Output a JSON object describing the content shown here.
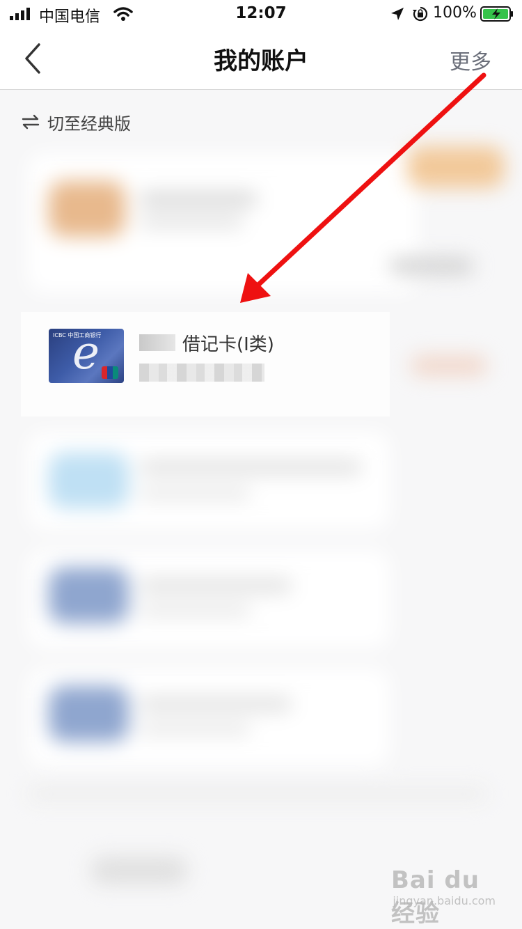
{
  "status_bar": {
    "carrier": "中国电信",
    "time": "12:07",
    "battery": "100%"
  },
  "nav": {
    "title": "我的账户",
    "more_label": "更多"
  },
  "switch_version": {
    "label": "切至经典版"
  },
  "account": {
    "title": "借记卡(Ⅰ类)",
    "card_brand": "ICBC 中国工商银行"
  },
  "colors": {
    "annotation_arrow": "#ee1111",
    "background": "#f7f7f8"
  },
  "watermark": {
    "logo": "Bai du 经验",
    "url": "jingyan.baidu.com"
  }
}
